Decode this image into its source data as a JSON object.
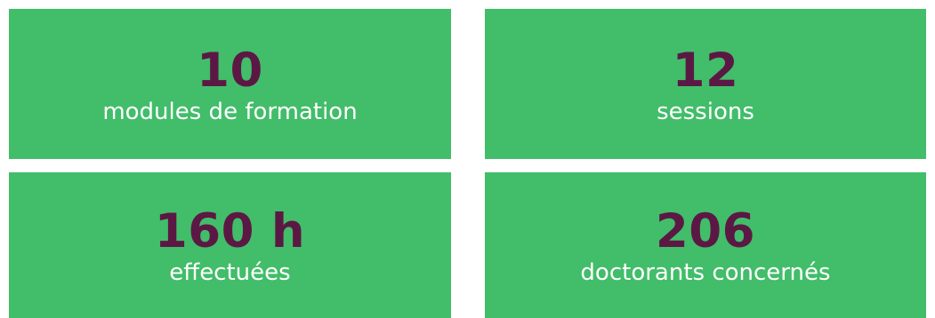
{
  "colors": {
    "card_background": "#42bd6a",
    "value_text": "#5c1844",
    "label_text": "#ffffff"
  },
  "stats": [
    {
      "value": "10",
      "label": "modules de formation"
    },
    {
      "value": "12",
      "label": "sessions"
    },
    {
      "value": "160 h",
      "label": "effectuées"
    },
    {
      "value": "206",
      "label": "doctorants concernés"
    }
  ]
}
